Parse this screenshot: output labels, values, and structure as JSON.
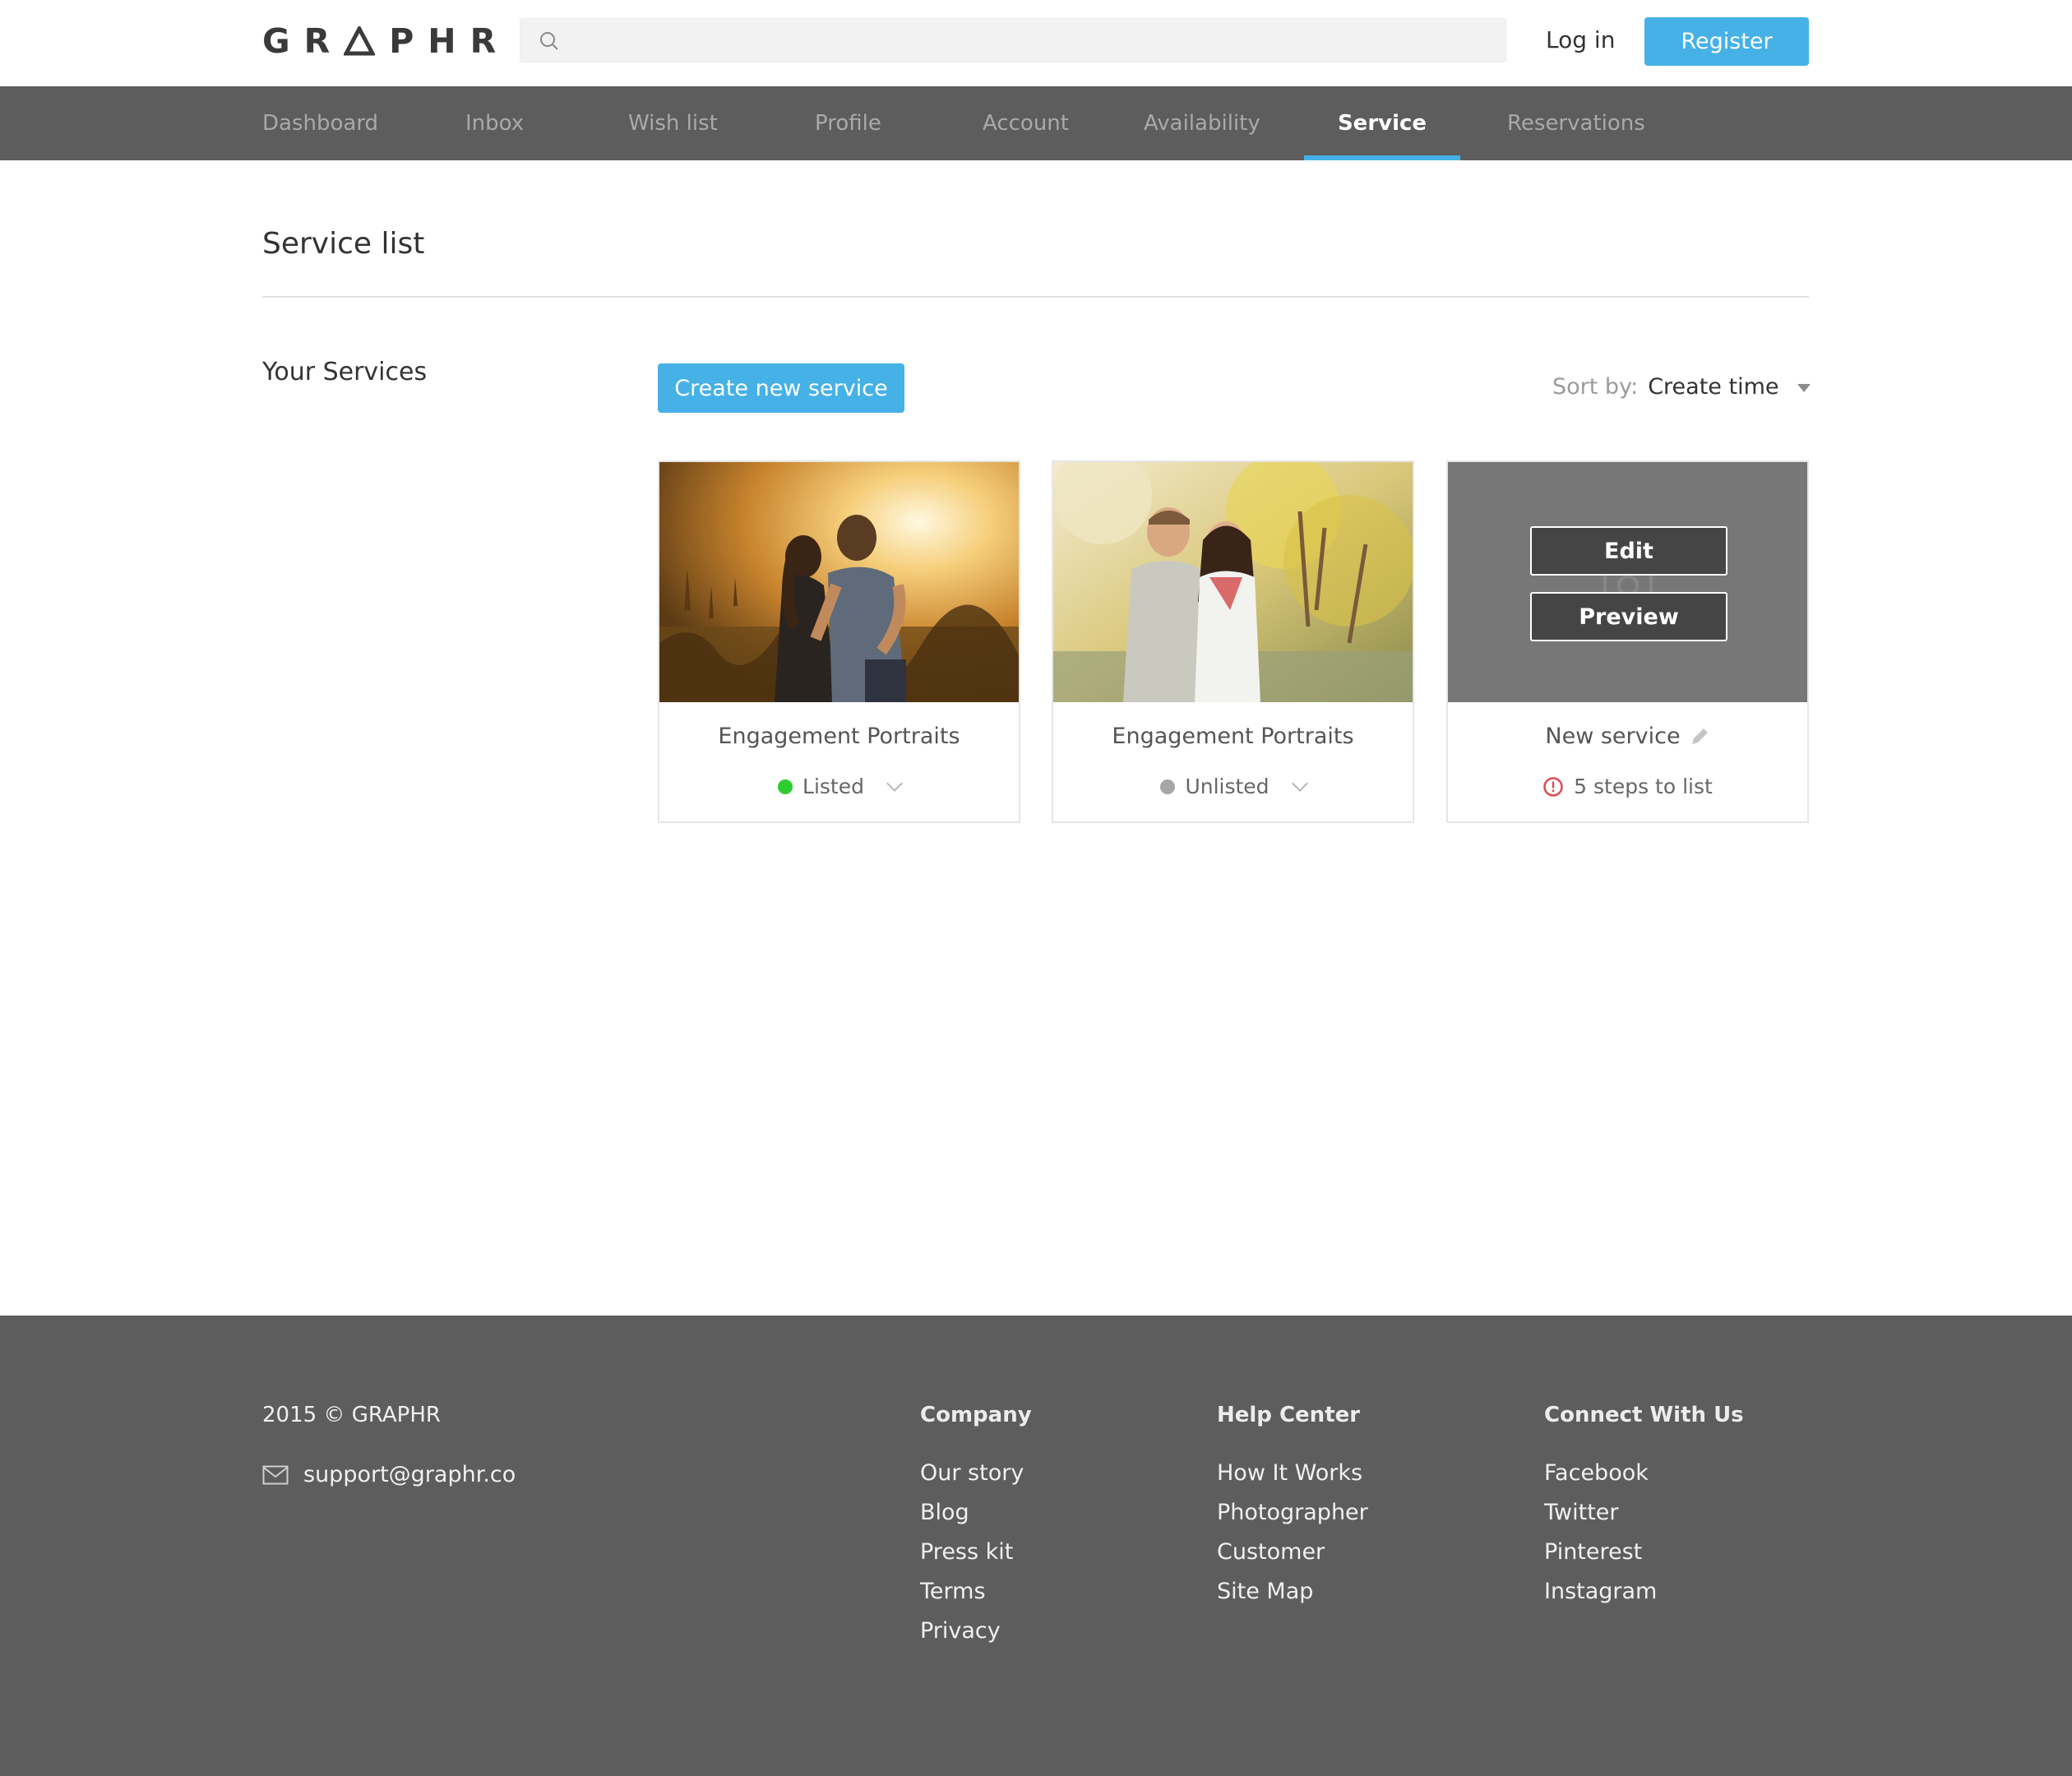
{
  "header": {
    "logo": "GRAPHR",
    "search_placeholder": "",
    "login_label": "Log in",
    "register_label": "Register",
    "accent": "#45b1e6"
  },
  "nav": {
    "items": [
      {
        "label": "Dashboard",
        "active": false
      },
      {
        "label": "Inbox",
        "active": false
      },
      {
        "label": "Wish list",
        "active": false
      },
      {
        "label": "Profile",
        "active": false
      },
      {
        "label": "Account",
        "active": false
      },
      {
        "label": "Availability",
        "active": false
      },
      {
        "label": "Service",
        "active": true
      },
      {
        "label": "Reservations",
        "active": false
      }
    ]
  },
  "main": {
    "page_title": "Service list",
    "section_label": "Your Services",
    "create_button": "Create new service",
    "sort_label": "Sort by:",
    "sort_value": "Create time",
    "cards": [
      {
        "title": "Engagement Portraits",
        "status": "Listed",
        "status_color": "#2ecc2e",
        "image": "couple-desert-photo"
      },
      {
        "title": "Engagement Portraits",
        "status": "Unlisted",
        "status_color": "#a6a6a6",
        "image": "couple-park-photo"
      },
      {
        "title": "New service",
        "status": "5 steps to list",
        "status_color": "#e0474c",
        "edit_label": "Edit",
        "preview_label": "Preview",
        "image": "camera-placeholder"
      }
    ]
  },
  "footer": {
    "copyright": "2015 © GRAPHR",
    "email": "support@graphr.co",
    "columns": [
      {
        "heading": "Company",
        "links": [
          "Our story",
          "Blog",
          "Press kit",
          "Terms",
          "Privacy"
        ]
      },
      {
        "heading": "Help Center",
        "links": [
          "How It Works",
          "Photographer",
          "Customer",
          "Site Map"
        ]
      },
      {
        "heading": "Connect With Us",
        "links": [
          "Facebook",
          "Twitter",
          "Pinterest",
          "Instagram"
        ]
      }
    ]
  }
}
